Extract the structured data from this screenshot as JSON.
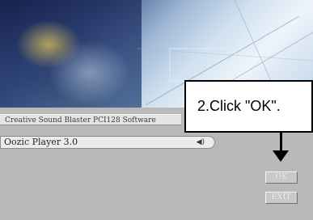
{
  "software_info": "Creative Sound Blaster PCI128 Software",
  "player_select": {
    "value": "Oozic Player 3.0",
    "arrow": "◀)"
  },
  "callout": {
    "text": "2.Click \"OK\"."
  },
  "buttons": {
    "ok_label": "OK",
    "exit_label": "EXIT"
  },
  "icons": {
    "pointer": "arrow-down-icon"
  }
}
